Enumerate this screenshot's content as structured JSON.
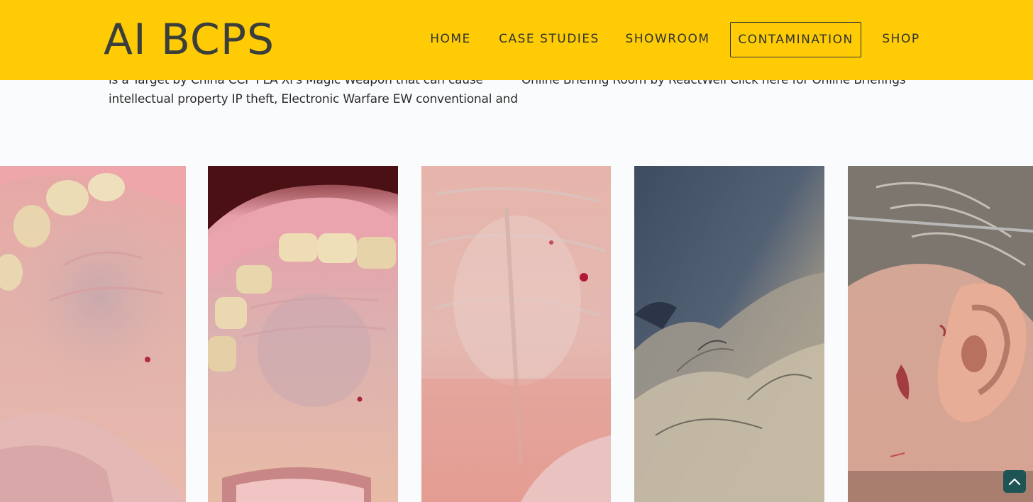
{
  "site": {
    "logo": "AI BCPS"
  },
  "nav": {
    "items": [
      {
        "label": "HOME"
      },
      {
        "label": "CASE STUDIES"
      },
      {
        "label": "SHOWROOM"
      },
      {
        "label": "CONTAMINATION",
        "active": true
      },
      {
        "label": "SHOP"
      }
    ]
  },
  "intro": {
    "left_lines": [
      "is a Target by China CCP PLA Xi's Magic Weapon that can cause",
      "intellectual property IP theft, Electronic Warfare EW conventional and"
    ],
    "right_lines": [
      "Online Briefing Room by ReactWell Click here for Online Briefings"
    ]
  },
  "gallery": {
    "photos": [
      {
        "subject": "palate-closeup-1"
      },
      {
        "subject": "upper-teeth-palate"
      },
      {
        "subject": "palate-closeup-2"
      },
      {
        "subject": "fabric-texture"
      },
      {
        "subject": "ear-with-lesions"
      }
    ]
  },
  "icons": {
    "back_to_top": "chevron-up-icon"
  },
  "colors": {
    "header_bg": "#ffcb05",
    "text_dark": "#3a3f3c",
    "back_to_top_bg": "#1f5454"
  }
}
